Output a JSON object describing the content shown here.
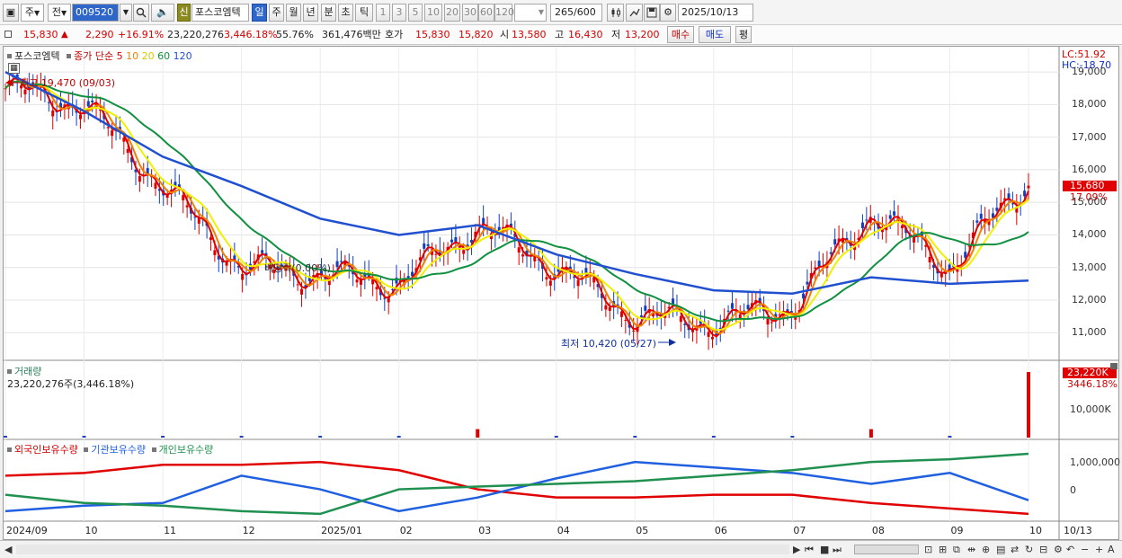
{
  "toolbar": {
    "period_select": "주",
    "prev_label": "전",
    "stock_code": "009520",
    "credit_badge": "신",
    "stock_name": "포스코엠텍",
    "period_tabs": [
      "일",
      "주",
      "월",
      "년",
      "분",
      "초",
      "틱"
    ],
    "interval_buttons": [
      "1",
      "3",
      "5",
      "10",
      "20",
      "30",
      "60",
      "120"
    ],
    "bar_count": "265",
    "bar_total": "/600",
    "date": "2025/10/13"
  },
  "quote": {
    "price": "15,830",
    "change_arrow": "▲",
    "change": "2,290",
    "change_pct": "+16.91%",
    "volume": "23,220,276",
    "volume_pct": "3,446.18%",
    "turnover": "55.76%",
    "amount": "361,476백만",
    "hoga_label": "호가",
    "ask": "15,830",
    "bid": "15,820",
    "open_label": "시",
    "open": "13,580",
    "high_label": "고",
    "high": "16,430",
    "low_label": "저",
    "low": "13,200",
    "buy_label": "매수",
    "sell_label": "매도",
    "eval_label": "평"
  },
  "price_panel": {
    "name": "포스코엠텍",
    "ma_title": "종가 단순",
    "ma_periods": [
      "5",
      "10",
      "20",
      "60",
      "120"
    ],
    "ma_colors": [
      "#e00000",
      "#f08000",
      "#f0f000",
      "#109040",
      "#2050d0"
    ],
    "lc": "LC:51.92",
    "hc": "HC:-18.70",
    "high_note": "최고 19,470 (09/03)",
    "low_note": "최저 10,420 (05/27)",
    "dividend_note": "배당락(0.00%)",
    "current_price_tag": "15,680",
    "current_pct_tag": "17.09%",
    "y_ticks": [
      "19,000",
      "18,000",
      "17,000",
      "16,000",
      "15,000",
      "14,000",
      "13,000",
      "12,000",
      "11,000"
    ]
  },
  "volume_panel": {
    "title": "거래량",
    "summary": "23,220,276주(3,446.18%)",
    "tag_value": "23,220K",
    "tag_pct": "3446.18%",
    "y_tick": "10,000K"
  },
  "holdings_panel": {
    "legend": [
      "외국인보유수량",
      "기관보유수량",
      "개인보유수량"
    ],
    "colors": [
      "#e00000",
      "#2060e0",
      "#209050"
    ],
    "y_ticks": [
      "1,000,000",
      "0"
    ]
  },
  "x_axis": [
    "2024/09",
    "10",
    "11",
    "12",
    "2025/01",
    "02",
    "03",
    "04",
    "05",
    "06",
    "07",
    "08",
    "09",
    "10",
    "10/13"
  ],
  "chart_data": [
    {
      "type": "line",
      "title": "포스코엠텍 종가 단순 5 10 20 60 120",
      "x": [
        "2024/09",
        "10",
        "11",
        "12",
        "2025/01",
        "02",
        "03",
        "04",
        "05",
        "06",
        "07",
        "08",
        "09",
        "10"
      ],
      "series": [
        {
          "name": "종가",
          "values": [
            18500,
            18000,
            15500,
            13000,
            12800,
            12500,
            14300,
            13000,
            11500,
            11300,
            11800,
            14700,
            13000,
            15680
          ]
        },
        {
          "name": "120",
          "values": [
            19000,
            17800,
            16400,
            15500,
            14500,
            14000,
            14300,
            13400,
            12800,
            12300,
            12200,
            12700,
            12500,
            12600
          ]
        }
      ],
      "ylim": [
        10400,
        19500
      ]
    },
    {
      "type": "bar",
      "title": "거래량",
      "x": [
        "2024/09",
        "10",
        "11",
        "12",
        "2025/01",
        "02",
        "03",
        "04",
        "05",
        "06",
        "07",
        "08",
        "09",
        "10"
      ],
      "values": [
        300,
        250,
        200,
        150,
        200,
        150,
        3000,
        400,
        200,
        200,
        150,
        3000,
        200,
        23220
      ],
      "ylabel": "K"
    },
    {
      "type": "line",
      "title": "보유수량",
      "x": [
        "2024/09",
        "10",
        "11",
        "12",
        "2025/01",
        "02",
        "03",
        "04",
        "05",
        "06",
        "07",
        "08",
        "09",
        "10"
      ],
      "series": [
        {
          "name": "외국인보유수량",
          "values": [
            500000,
            600000,
            900000,
            900000,
            1000000,
            700000,
            0,
            -300000,
            -300000,
            -200000,
            -200000,
            -500000,
            -700000,
            -900000
          ]
        },
        {
          "name": "기관보유수량",
          "values": [
            -800000,
            -600000,
            -500000,
            500000,
            0,
            -800000,
            -300000,
            400000,
            1000000,
            800000,
            600000,
            200000,
            600000,
            -400000
          ]
        },
        {
          "name": "개인보유수량",
          "values": [
            -200000,
            -500000,
            -600000,
            -800000,
            -900000,
            0,
            100000,
            200000,
            300000,
            500000,
            700000,
            1000000,
            1100000,
            1300000
          ]
        }
      ],
      "ylim": [
        -1100000,
        1400000
      ]
    }
  ]
}
